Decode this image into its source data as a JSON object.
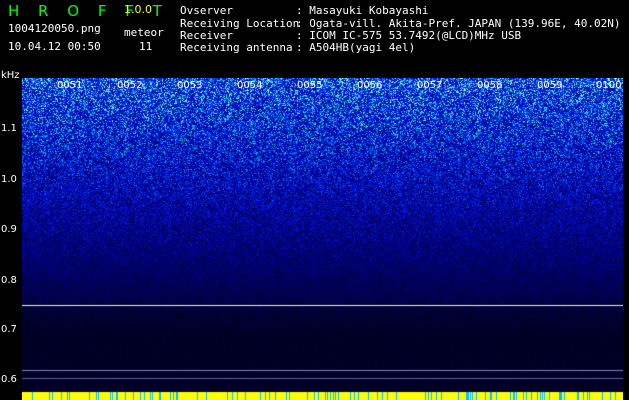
{
  "app": {
    "title": "H R O F F T",
    "version": "1.0.0"
  },
  "capture": {
    "filename": "1004120050.png",
    "datetime": "10.04.12 00:50",
    "meteor_label": "meteor",
    "meteor_count": "11"
  },
  "info": [
    {
      "label": "Ovserver",
      "value": ": Masayuki Kobayashi"
    },
    {
      "label": "Receiving Location",
      "value": ": Ogata-vill. Akita-Pref. JAPAN (139.96E, 40.02N)"
    },
    {
      "label": "Receiver",
      "value": ": ICOM IC-575 53.7492(@LCD)MHz USB"
    },
    {
      "label": "Receiving antenna",
      "value": ": A504HB(yagi 4el)"
    }
  ],
  "axis": {
    "y_unit": "kHz",
    "y_ticks": [
      "1.1",
      "1.0",
      "0.9",
      "0.8",
      "0.7",
      "0.6"
    ],
    "y_values": [
      1.1,
      1.0,
      0.9,
      0.8,
      0.7,
      0.6
    ],
    "x_ticks": [
      "0051",
      "0052",
      "0053",
      "0054",
      "0055",
      "0056",
      "0057",
      "0058",
      "0059",
      "0100"
    ]
  },
  "colors": {
    "title": "#00ff00",
    "label_green": "#00ff00",
    "info_text": "#ffffff",
    "version": "#ffff00",
    "axis_text": "#ffffff",
    "tick_text": "#ffff00",
    "carrier": "#ffff66",
    "bottom_band": "#ffff00"
  }
}
